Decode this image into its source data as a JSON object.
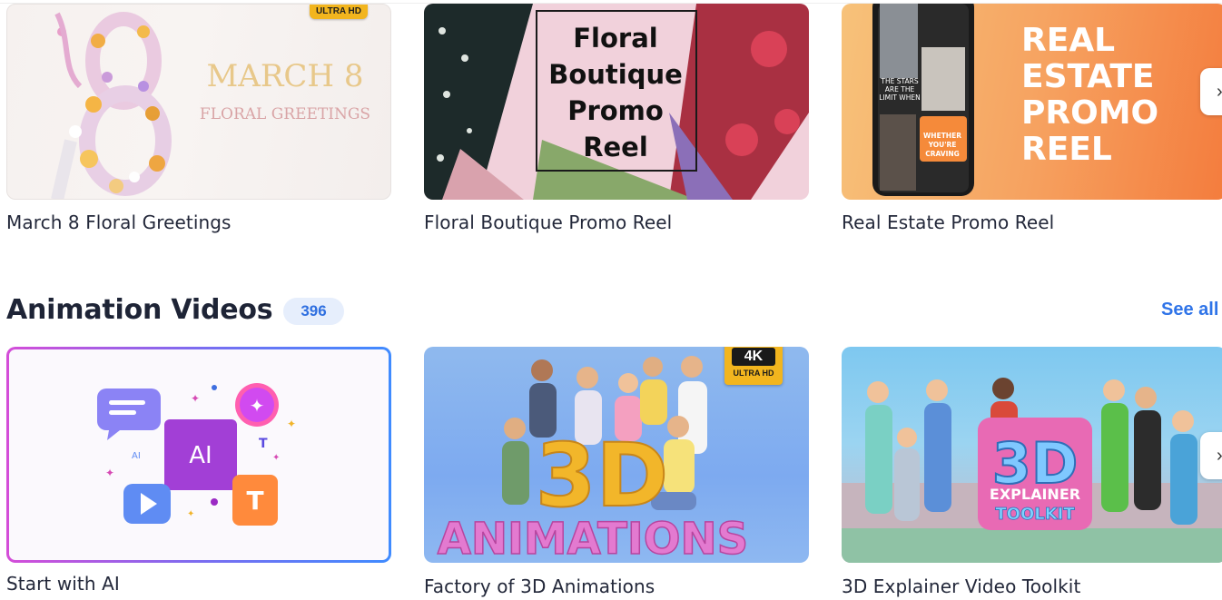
{
  "row1": {
    "cards": [
      {
        "title": "March 8 Floral Greetings",
        "thumb_heading": "MARCH 8",
        "thumb_sub": "FLORAL GREETINGS",
        "badge": "ULTRA HD"
      },
      {
        "title": "Floral Boutique Promo Reel",
        "thumb_lines": [
          "Floral",
          "Boutique",
          "Promo",
          "Reel"
        ]
      },
      {
        "title": "Real Estate Promo Reel",
        "thumb_lines": [
          "REAL",
          "ESTATE",
          "PROMO",
          "REEL"
        ],
        "phone_text_1": "THE STARS ARE THE LIMIT WHEN",
        "phone_text_2": "WHETHER YOU'RE CRAVING"
      }
    ]
  },
  "section": {
    "title": "Animation Videos",
    "count": "396",
    "see_all": "See all"
  },
  "row2": {
    "cards": [
      {
        "title": "Start with AI",
        "ai_label": "AI",
        "ai_small": "AI"
      },
      {
        "title": "Factory of 3D Animations",
        "badge_4k": "4K",
        "badge_uhd": "ULTRA HD",
        "thumb_big": "3D",
        "thumb_word": "ANIMATIONS"
      },
      {
        "title": "3D Explainer Video Toolkit",
        "thumb_big": "3D",
        "thumb_line1": "EXPLAINER",
        "thumb_line2": "TOOLKIT"
      }
    ]
  },
  "colors": {
    "accent": "#2f74e8",
    "badge": "#f2b51e",
    "heading": "#1e2436"
  },
  "icons": [
    "chevron-right-icon",
    "play-icon",
    "chat-icon",
    "sparkle-icon",
    "text-icon"
  ]
}
